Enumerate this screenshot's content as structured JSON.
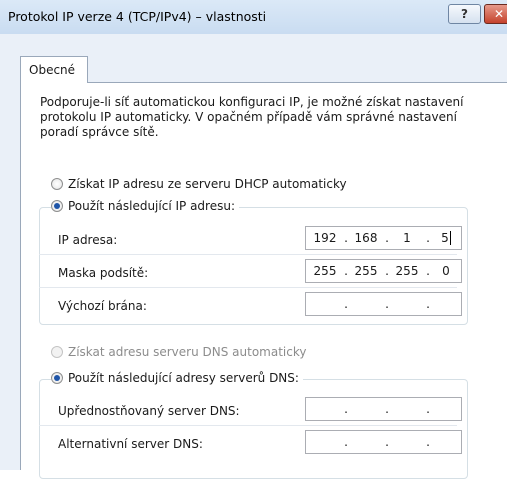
{
  "window": {
    "title": "Protokol IP verze 4 (TCP/IPv4) – vlastnosti",
    "help_label": "?",
    "close_label": "✕"
  },
  "tabs": [
    {
      "label": "Obecné"
    }
  ],
  "description": "Podporuje-li síť automatickou konfiguraci IP, je možné získat nastavení protokolu IP automaticky. V opačném případě vám správné nastavení poradí správce sítě.",
  "ip_section": {
    "auto_label": "Získat IP adresu ze serveru DHCP automaticky",
    "manual_label": "Použít následující IP adresu:",
    "selected": "manual",
    "fields": [
      {
        "label": "IP adresa:",
        "octets": [
          "192",
          "168",
          "1",
          "5"
        ]
      },
      {
        "label": "Maska podsítě:",
        "octets": [
          "255",
          "255",
          "255",
          "0"
        ]
      },
      {
        "label": "Výchozí brána:",
        "octets": [
          "",
          "",
          "",
          ""
        ]
      }
    ]
  },
  "dns_section": {
    "auto_label": "Získat adresu serveru DNS automaticky",
    "manual_label": "Použít následující adresy serverů DNS:",
    "selected": "manual",
    "auto_disabled": true,
    "fields": [
      {
        "label": "Upřednostňovaný server DNS:",
        "octets": [
          "",
          "",
          "",
          ""
        ]
      },
      {
        "label": "Alternativní server DNS:",
        "octets": [
          "",
          "",
          "",
          ""
        ]
      }
    ]
  },
  "colors": {
    "titlebar": "#c9dcf1",
    "dialog_bg": "#eaf0f8",
    "radio_dot": "#1f55a8",
    "close_button": "#c4422c"
  }
}
